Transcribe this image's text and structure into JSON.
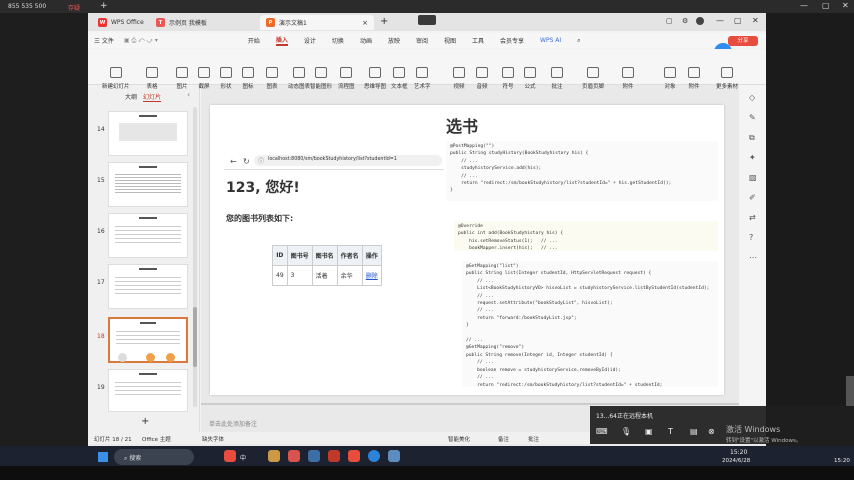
{
  "topbar": {
    "caller": "855 535 500",
    "record": "存疑"
  },
  "window": {
    "tabs": [
      {
        "label": "WPS Office"
      },
      {
        "label": "示例页 我模板"
      },
      {
        "label": "演示文稿1"
      }
    ],
    "add_tab": "+"
  },
  "menu": {
    "file": "三 文件",
    "items": [
      "开始",
      "插入",
      "设计",
      "切换",
      "动画",
      "放映",
      "审阅",
      "视图",
      "工具",
      "会员专享"
    ],
    "ai": "WPS AI",
    "share": "分享",
    "timer": "01:47"
  },
  "toolbar": [
    "新建幻灯片",
    "表格",
    "图片",
    "截屏",
    "形状",
    "图标",
    "图表",
    "动态图表",
    "智能图形",
    "流程图",
    "思维导图",
    "文本框",
    "艺术字",
    "视频",
    "音频",
    "符号",
    "公式",
    "批注",
    "页眉页脚",
    "附件",
    "对象",
    "附件",
    "更多素材"
  ],
  "sidebar": {
    "tab_outline": "大纲",
    "tab_slides": "幻灯片",
    "collapse": "‹",
    "slides": [
      {
        "num": "14"
      },
      {
        "num": "15"
      },
      {
        "num": "16"
      },
      {
        "num": "17"
      },
      {
        "num": "18"
      },
      {
        "num": "19"
      }
    ],
    "add": "+"
  },
  "slide": {
    "title": "选书",
    "browser_url": "localhost:8080/sm/bookStudyhistory/list?studentId=1",
    "greeting": "123, 您好!",
    "subtitle": "您的图书列表如下:",
    "table": {
      "headers": [
        "ID",
        "图书号",
        "图书名",
        "作者名",
        "操作"
      ],
      "row": [
        "49",
        "3",
        "活着",
        "余华",
        "删除"
      ]
    },
    "code1": "@PostMapping(\"\")\npublic String studyHistory(BookStudyhistory his) {\n    // ...\n    studyhistoryService.add(his);\n    // ...\n    return \"redirect:/sm/bookStudyhistory/list?studentId=\" + his.getStudentId();\n}",
    "code2": "@Override\npublic int add(BookStudyhistory his) {\n    his.setRemoveStatus(1);   // ...\n    bookMapper.insert(his);   // ...",
    "code3": "@GetMapping(\"list\")\npublic String list(Integer studentId, HttpServletRequest request) {\n    // ...\n    List<BookStudyhistoryVO> hisvoList = studyhistoryService.listByStudentId(studentId);\n    // ...\n    request.setAttribute(\"bookStudyList\", hisvoList);\n    // ...\n    return \"forward:/bookStudyList.jsp\";\n}\n\n// ...\n@GetMapping(\"remove\")\npublic String remove(Integer id, Integer studentId) {\n    // ...\n    boolean remove = studyhistoryService.removeById(id);\n    // ...\n    return \"redirect:/sm/bookStudyhistory/list?studentId=\" + studentId;\n}"
  },
  "notes_placeholder": "单击此处添加备注",
  "status": {
    "slide_count": "幻灯片 18 / 21",
    "theme": "Office 主题",
    "font_missing": "缺失字体",
    "smart": "智能美化",
    "notes": "备注",
    "comment": "批注",
    "zoom": "86%"
  },
  "remote": {
    "label": "13...64正在远程本机"
  },
  "watermark": {
    "line1": "激活 Windows",
    "line2": "转到\"设置\"以激活 Windows。"
  },
  "taskbar": {
    "search": "搜索",
    "time": "15:20",
    "date": "2024/6/28",
    "ime": "中",
    "clock_right": "15:20"
  }
}
